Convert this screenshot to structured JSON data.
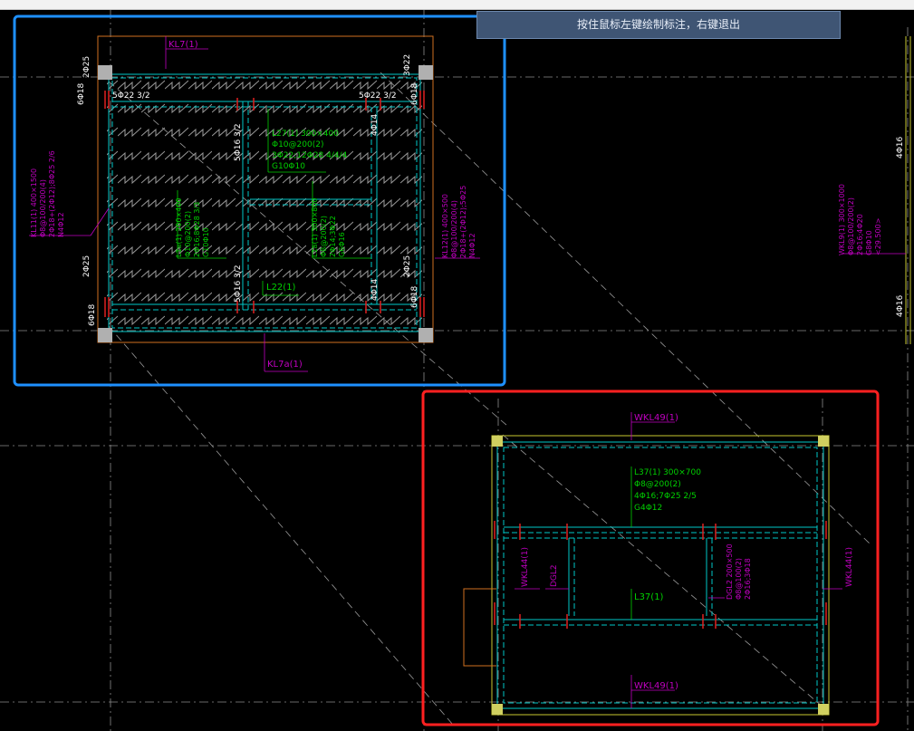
{
  "status_hint": "按住鼠标左键绘制标注，右键退出",
  "colors": {
    "background": "#000000",
    "beam_cyan": "#00c8c8",
    "label_magenta": "#c000c0",
    "label_green": "#00d000",
    "column_gray": "#b0b0b0",
    "rebar_red": "#e02020",
    "frame_orange": "#d07020",
    "frame_yellow": "#c8c830",
    "highlight_blue": "#1e90ff",
    "highlight_red": "#ff2020"
  },
  "left_plan": {
    "top_beam_label": "KL7(1)",
    "bottom_beam_label": "KL7a(1)",
    "left_beam_text": [
      "KL11(1) 400×1500",
      "Φ8@100/200(4)",
      "2Φ18+(2Φ12);8Φ25 2/6",
      "N4Φ12"
    ],
    "right_beam_text": [
      "KL12(1) 400×500",
      "Φ8@100/200(4)",
      "2Φ18+(2Φ12);5Φ25",
      "N4Φ12"
    ],
    "rebar_left_top_vertical": "2Φ25",
    "rebar_right_top_vertical": "3Φ22",
    "rebar_left_side_top": "6Φ18",
    "rebar_right_side_top": "6Φ18",
    "rebar_left_bottom_vertical": "2Φ25",
    "rebar_right_bottom_vertical": "2Φ25",
    "rebar_left_side_bottom": "6Φ18",
    "rebar_right_side_bottom": "6Φ18",
    "top_span_left": "5Φ22 3/2",
    "top_span_right": "5Φ22 3/2",
    "mid_vertical_top": "5Φ16 3/2",
    "mid_vertical_bottom": "5Φ16 3/2",
    "right_inner_top": "4Φ14",
    "right_inner_bottom": "4Φ14",
    "center_beam_text": [
      "L27(1) 300×400",
      "Φ10@200(2)",
      "3Φ22;12Φ28 4/4/4",
      "G10Φ10"
    ],
    "left_inner_text": [
      "L1a(1) 200×400",
      "Φ10@200(2)",
      "2Φ16;8Φ28 3/3",
      "G10Φ10"
    ],
    "right_inner_text": [
      "L1a(1) 300×800",
      "Φ8@200(2)",
      "2Φ14;3Φ22",
      "G6Φ16"
    ],
    "small_beam_label": "L22(1)"
  },
  "right_far": {
    "label_top": "4Φ16",
    "label_bottom": "4Φ16",
    "beam_text": [
      "WKL9(1) 300×1000",
      "Φ8@100/200(2)",
      "2Φ16;4Φ20",
      "G8Φ10",
      "<29.500>"
    ]
  },
  "right_plan": {
    "top_beam_label": "WKL49(1)",
    "bottom_beam_label": "WKL49(1)",
    "left_beam_label": "WKL44(1)",
    "right_beam_label": "WKL44(1)",
    "dgl_left_label": "DGL2",
    "dgl_right_text": [
      "DGL2 200×500",
      "Φ8@100(2)",
      "2Φ16;3Φ18"
    ],
    "center_beam_text": [
      "L37(1) 300×700",
      "Φ8@200(2)",
      "4Φ16;7Φ25 2/5",
      "G4Φ12"
    ],
    "lower_beam_label": "L37(1)"
  }
}
